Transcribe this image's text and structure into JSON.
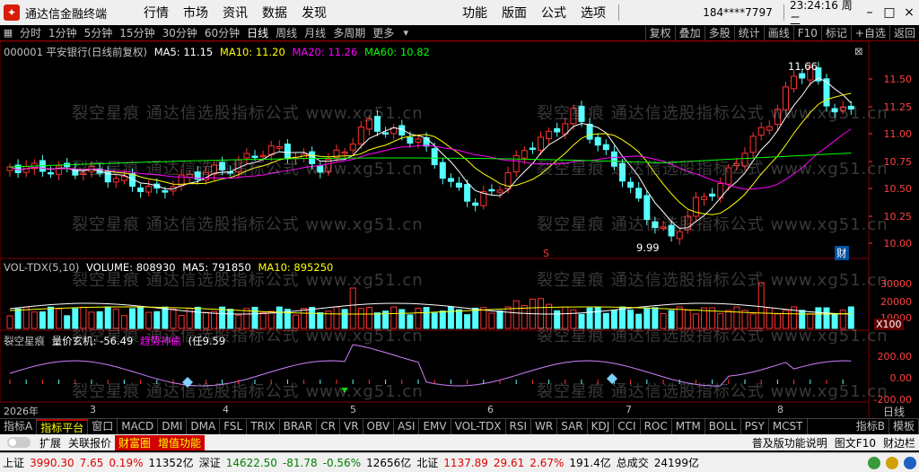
{
  "titlebar": {
    "app_name": "通达信金融终端",
    "menus_left": [
      "行情",
      "市场",
      "资讯",
      "数据",
      "发现"
    ],
    "menus_right": [
      "功能",
      "版面",
      "公式",
      "选项"
    ],
    "user": "184****7797",
    "time": "23:24:16 周二",
    "window_buttons": [
      "–",
      "□",
      "×"
    ]
  },
  "periodbar": {
    "periods": [
      "分时",
      "1分钟",
      "5分钟",
      "15分钟",
      "30分钟",
      "60分钟",
      "日线",
      "周线",
      "月线",
      "多周期",
      "更多"
    ],
    "active_period": "日线",
    "tools": [
      "复权",
      "叠加",
      "多股",
      "统计",
      "画线",
      "F10",
      "标记",
      "+自选",
      "返回"
    ]
  },
  "price_panel": {
    "stock_line": "000001 平安银行(日线前复权)",
    "ma_labels": [
      {
        "text": "MA5: 11.15",
        "color": "#ffffff"
      },
      {
        "text": "MA10: 11.20",
        "color": "#ffff00"
      },
      {
        "text": "MA20: 11.26",
        "color": "#ff00ff"
      },
      {
        "text": "MA60: 10.82",
        "color": "#00ff00"
      }
    ],
    "y_ticks": [
      "11.50",
      "11.25",
      "11.00",
      "10.75",
      "10.50",
      "10.25",
      "10.00"
    ],
    "high_label": "11.66",
    "low_label": "9.99",
    "marker_s": "S",
    "marker_cai": "财"
  },
  "volume_panel": {
    "title": "VOL-TDX(5,10)",
    "values": [
      {
        "text": "VOLUME: 808930",
        "color": "#ffffff"
      },
      {
        "text": "MA5: 791850",
        "color": "#ffffff"
      },
      {
        "text": "MA10: 895250",
        "color": "#ffff00"
      }
    ],
    "y_ticks": [
      "30000",
      "20000",
      "10000"
    ],
    "unit": "X100"
  },
  "indicator_panel": {
    "title": "裂空星痕",
    "values": [
      {
        "text": "量价玄机: -56.49",
        "color": "#ffffff"
      },
      {
        "text": "趋势神偷",
        "color": "#ff00ff"
      },
      {
        "text": "(任9.59",
        "color": "#ffffff"
      }
    ],
    "y_ticks": [
      "200.00",
      "0.00",
      "-200.00"
    ]
  },
  "timeline": {
    "year_label": "2026年",
    "months": [
      "3",
      "4",
      "5",
      "6",
      "7",
      "8"
    ],
    "corner_label": "日线"
  },
  "watermark": "裂空星痕  通达信选股指标公式  www.xg51.cn",
  "tabbar": {
    "tabs": [
      "指标A",
      "指标平台",
      "窗口",
      "MACD",
      "DMI",
      "DMA",
      "FSL",
      "TRIX",
      "BRAR",
      "CR",
      "VR",
      "OBV",
      "ASI",
      "EMV",
      "VOL-TDX",
      "RSI",
      "WR",
      "SAR",
      "KDJ",
      "CCI",
      "ROC",
      "MTM",
      "BOLL",
      "PSY",
      "MCST"
    ],
    "active_tab": "指标平台",
    "right_tabs": [
      "指标B",
      "模板"
    ]
  },
  "subbar": {
    "items": [
      "扩展",
      "关联报价",
      "财富圈",
      "增值功能"
    ],
    "hot_items": [
      "财富圈",
      "增值功能"
    ],
    "right_items": [
      "普及版功能说明",
      "图文F10",
      "财边栏"
    ]
  },
  "statusbar": {
    "sh": {
      "name": "上证",
      "value": "3990.30",
      "change": "7.65",
      "pct": "0.19%",
      "amount": "11352亿"
    },
    "sz": {
      "name": "深证",
      "value": "14622.50",
      "change": "-81.78",
      "pct": "-0.56%",
      "amount": "12656亿"
    },
    "bj": {
      "name": "北证",
      "value": "1137.89",
      "change": "29.61",
      "pct": "2.67%",
      "amount": "191.4亿"
    },
    "total_label": "总成交",
    "total_value": "24199亿"
  },
  "colors": {
    "up": "#ff3232",
    "down": "#54ffff",
    "ma5": "#ffffff",
    "ma10": "#ffff00",
    "ma20": "#ff00ff",
    "ma60": "#00ff00",
    "grid": "#800000"
  }
}
